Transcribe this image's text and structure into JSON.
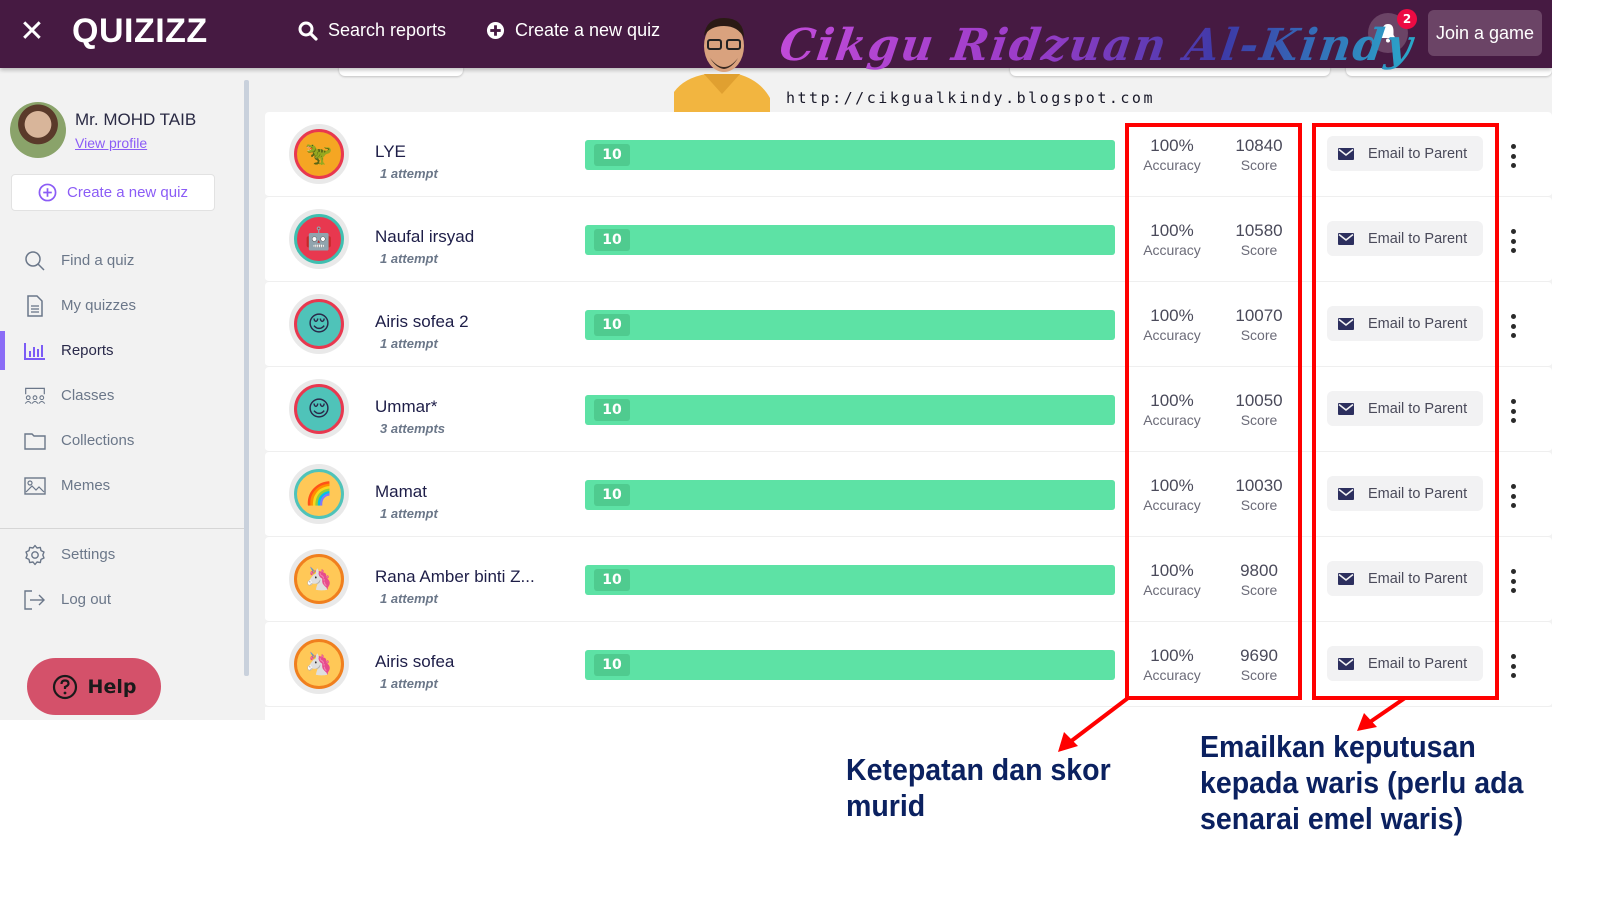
{
  "topbar": {
    "close_icon": "close-icon",
    "logo": "QUIZIZZ",
    "search_label": "Search reports",
    "create_label": "Create a new quiz",
    "notification_count": "2",
    "join_label": "Join a game"
  },
  "watermark": {
    "title": "Cikgu Ridzuan Al-Kindy",
    "url": "http://cikgualkindy.blogspot.com"
  },
  "sidebar": {
    "profile_name": "Mr. MOHD TAIB",
    "profile_link": "View profile",
    "create_label": "Create a new quiz",
    "items": [
      {
        "label": "Find a quiz",
        "icon": "search-icon",
        "active": false
      },
      {
        "label": "My quizzes",
        "icon": "document-icon",
        "active": false
      },
      {
        "label": "Reports",
        "icon": "bar-chart-icon",
        "active": true
      },
      {
        "label": "Classes",
        "icon": "classes-icon",
        "active": false
      },
      {
        "label": "Collections",
        "icon": "folder-icon",
        "active": false
      },
      {
        "label": "Memes",
        "icon": "image-icon",
        "active": false
      }
    ],
    "secondary_items": [
      {
        "label": "Settings",
        "icon": "gear-icon"
      },
      {
        "label": "Log out",
        "icon": "logout-icon"
      }
    ],
    "help_label": "Help"
  },
  "report": {
    "accuracy_label": "Accuracy",
    "score_label": "Score",
    "email_label": "Email to Parent",
    "rows": [
      {
        "name": "LYE",
        "attempts": "1 attempt",
        "correct": "10",
        "progress": 1.0,
        "accuracy": "100%",
        "score": "10840",
        "avatar": "dino",
        "avatar_color": "#f5a623",
        "avatar_ring": "#e8384f"
      },
      {
        "name": "Naufal irsyad",
        "attempts": "1 attempt",
        "correct": "10",
        "progress": 1.0,
        "accuracy": "100%",
        "score": "10580",
        "avatar": "robot",
        "avatar_color": "#e8384f",
        "avatar_ring": "#3fbfb0"
      },
      {
        "name": "Airis sofea 2",
        "attempts": "1 attempt",
        "correct": "10",
        "progress": 1.0,
        "accuracy": "100%",
        "score": "10070",
        "avatar": "ninja",
        "avatar_color": "#4fc3b9",
        "avatar_ring": "#e8384f"
      },
      {
        "name": "Ummar*",
        "attempts": "3 attempts",
        "correct": "10",
        "progress": 1.0,
        "accuracy": "100%",
        "score": "10050",
        "avatar": "ninja",
        "avatar_color": "#4fc3b9",
        "avatar_ring": "#e8384f"
      },
      {
        "name": "Mamat",
        "attempts": "1 attempt",
        "correct": "10",
        "progress": 1.0,
        "accuracy": "100%",
        "score": "10030",
        "avatar": "rainbow",
        "avatar_color": "#ffc857",
        "avatar_ring": "#4fc3b9"
      },
      {
        "name": "Rana Amber binti Z...",
        "attempts": "1 attempt",
        "correct": "10",
        "progress": 1.0,
        "accuracy": "100%",
        "score": "9800",
        "avatar": "unicorn",
        "avatar_color": "#ffc857",
        "avatar_ring": "#f07f1e"
      },
      {
        "name": "Airis sofea",
        "attempts": "1 attempt",
        "correct": "10",
        "progress": 1.0,
        "accuracy": "100%",
        "score": "9690",
        "avatar": "unicorn",
        "avatar_color": "#ffc857",
        "avatar_ring": "#f07f1e"
      }
    ]
  },
  "annotations": {
    "accuracy_note": "Ketepatan dan skor murid",
    "email_note": "Emailkan keputusan kepada waris (perlu ada senarai emel waris)",
    "highlight_color": "#ff0000",
    "note_color": "#0b2160"
  }
}
